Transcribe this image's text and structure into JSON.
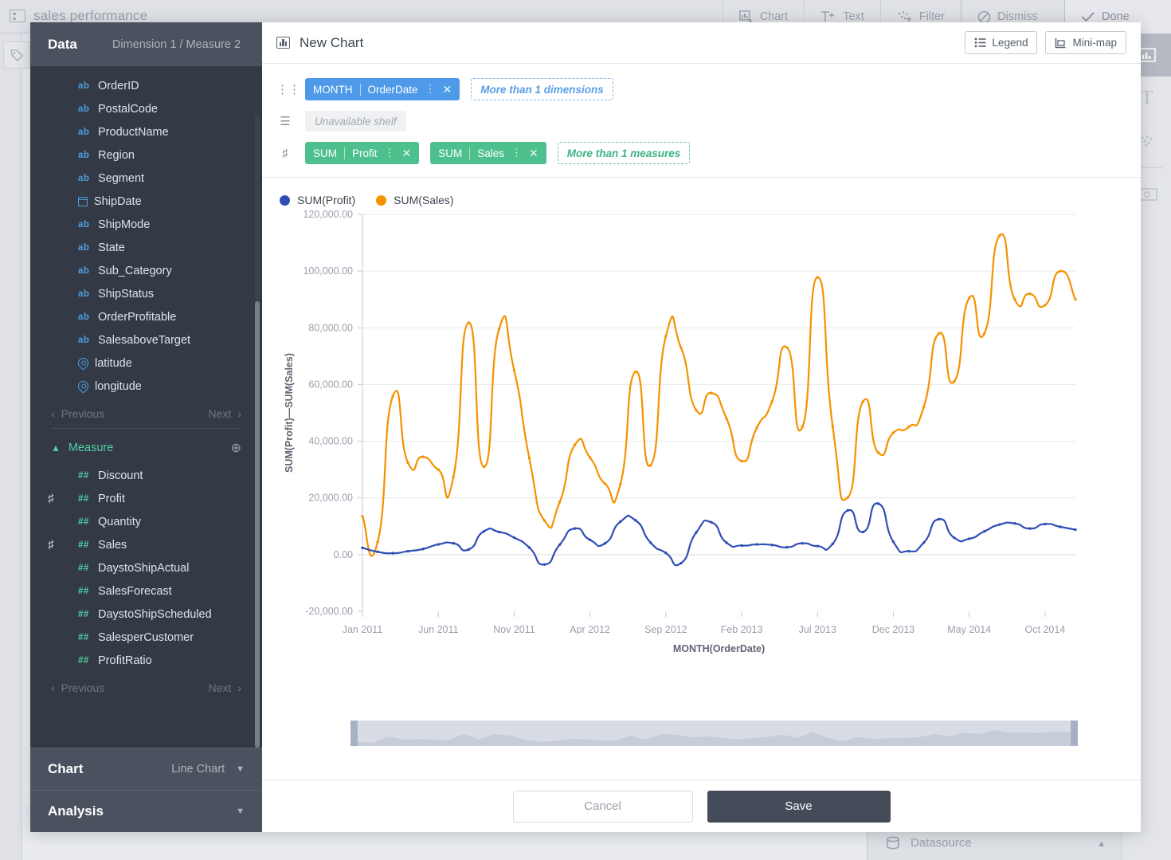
{
  "background": {
    "app_title": "sales performance",
    "toolbar": [
      {
        "label": "Chart",
        "icon": "chart-add-icon"
      },
      {
        "label": "Text",
        "icon": "text-add-icon"
      },
      {
        "label": "Filter",
        "icon": "filter-add-icon"
      },
      {
        "label": "Dismiss",
        "icon": "dismiss-icon"
      },
      {
        "label": "Done",
        "icon": "check-icon"
      }
    ],
    "datasource_label": "Datasource",
    "right_rail_icons": [
      "scatter-icon",
      "bar-chart-icon",
      "palette-icon",
      "number-123-icon",
      "y-axis-icon",
      "x-axis-icon",
      "text-box-icon",
      "comment-icon"
    ],
    "secondary_rail_icons": [
      "bar-chart-icon",
      "text-icon",
      "scatter-icon",
      "settings-icon"
    ]
  },
  "panel": {
    "title": "Data",
    "subtitle": "Dimension 1 / Measure 2",
    "dimension_fields": [
      {
        "name": "OrderID",
        "type": "ab",
        "icon": "abc-icon",
        "on_shelf": false
      },
      {
        "name": "PostalCode",
        "type": "ab",
        "icon": "abc-icon",
        "on_shelf": false
      },
      {
        "name": "ProductName",
        "type": "ab",
        "icon": "abc-icon",
        "on_shelf": false
      },
      {
        "name": "Region",
        "type": "ab",
        "icon": "abc-icon",
        "on_shelf": false
      },
      {
        "name": "Segment",
        "type": "ab",
        "icon": "abc-icon",
        "on_shelf": false
      },
      {
        "name": "ShipDate",
        "type": "date",
        "icon": "calendar-icon",
        "on_shelf": false
      },
      {
        "name": "ShipMode",
        "type": "ab",
        "icon": "abc-icon",
        "on_shelf": false
      },
      {
        "name": "State",
        "type": "ab",
        "icon": "abc-icon",
        "on_shelf": false
      },
      {
        "name": "Sub_Category",
        "type": "ab",
        "icon": "abc-icon",
        "on_shelf": false
      },
      {
        "name": "ShipStatus",
        "type": "ab",
        "icon": "abc-icon",
        "on_shelf": false
      },
      {
        "name": "OrderProfitable",
        "type": "ab",
        "icon": "abc-icon",
        "on_shelf": false
      },
      {
        "name": "SalesaboveTarget",
        "type": "ab",
        "icon": "abc-icon",
        "on_shelf": false
      },
      {
        "name": "latitude",
        "type": "geo",
        "icon": "location-icon",
        "on_shelf": false
      },
      {
        "name": "longitude",
        "type": "geo",
        "icon": "location-icon",
        "on_shelf": false
      }
    ],
    "dimension_pager": {
      "previous": "Previous",
      "next": "Next"
    },
    "measure_group": {
      "label": "Measure",
      "collapse_icon": "chevron-up-icon",
      "add_icon": "plus-circle-icon"
    },
    "measure_fields": [
      {
        "name": "Discount",
        "type": "##",
        "on_shelf": false
      },
      {
        "name": "Profit",
        "type": "##",
        "on_shelf": true
      },
      {
        "name": "Quantity",
        "type": "##",
        "on_shelf": false
      },
      {
        "name": "Sales",
        "type": "##",
        "on_shelf": true
      },
      {
        "name": "DaystoShipActual",
        "type": "##",
        "on_shelf": false
      },
      {
        "name": "SalesForecast",
        "type": "##",
        "on_shelf": false
      },
      {
        "name": "DaystoShipScheduled",
        "type": "##",
        "on_shelf": false
      },
      {
        "name": "SalesperCustomer",
        "type": "##",
        "on_shelf": false
      },
      {
        "name": "ProfitRatio",
        "type": "##",
        "on_shelf": false
      }
    ],
    "measure_pager": {
      "previous": "Previous",
      "next": "Next"
    },
    "chart_section": {
      "title": "Chart",
      "value": "Line Chart",
      "caret": "chevron-down-icon"
    },
    "analysis_section": {
      "title": "Analysis",
      "caret": "chevron-down-icon"
    }
  },
  "chart_header": {
    "icon": "bar-chart-icon",
    "name": "New Chart",
    "legend_button": "Legend",
    "minimap_button": "Mini-map"
  },
  "shelves": {
    "dimension_row": {
      "icon": "columns-icon",
      "pills": [
        {
          "agg": "MONTH",
          "field": "OrderDate"
        }
      ],
      "placeholder": "More than 1 dimensions"
    },
    "unavailable_row": {
      "icon": "rows-icon",
      "placeholder": "Unavailable  shelf"
    },
    "measure_row": {
      "icon": "hash-icon",
      "pills": [
        {
          "agg": "SUM",
          "field": "Profit"
        },
        {
          "agg": "SUM",
          "field": "Sales"
        }
      ],
      "placeholder": "More than 1 measures"
    }
  },
  "footer": {
    "cancel": "Cancel",
    "save": "Save"
  },
  "colors": {
    "profit": "#2f4eb5",
    "sales": "#f59200",
    "pill_blue": "#4e9ae8",
    "pill_green": "#4ec08e",
    "panel_dark": "#333a45",
    "panel_head": "#4a525f",
    "save_button": "#454c59"
  },
  "chart_data": {
    "type": "line",
    "title": "",
    "xlabel": "MONTH(OrderDate)",
    "ylabel": "SUM(Profit)—SUM(Sales)",
    "ylim": [
      -20000,
      120000
    ],
    "yticks": [
      -20000,
      0,
      20000,
      40000,
      60000,
      80000,
      100000,
      120000
    ],
    "ytick_labels": [
      "-20,000.00",
      "0.00",
      "20,000.00",
      "40,000.00",
      "60,000.00",
      "80,000.00",
      "100,000.00",
      "120,000.00"
    ],
    "xtick_labels": [
      "Jan 2011",
      "Jun 2011",
      "Nov 2011",
      "Apr 2012",
      "Sep 2012",
      "Feb 2013",
      "Jul 2013",
      "Dec 2013",
      "May 2014",
      "Oct 2014"
    ],
    "grid": true,
    "legend_position": "top-left",
    "x": [
      "Jan 2011",
      "Feb 2011",
      "Mar 2011",
      "Apr 2011",
      "May 2011",
      "Jun 2011",
      "Jul 2011",
      "Aug 2011",
      "Sep 2011",
      "Oct 2011",
      "Nov 2011",
      "Dec 2011",
      "Jan 2012",
      "Feb 2012",
      "Mar 2012",
      "Apr 2012",
      "May 2012",
      "Jun 2012",
      "Jul 2012",
      "Aug 2012",
      "Sep 2012",
      "Oct 2012",
      "Nov 2012",
      "Dec 2012",
      "Jan 2013",
      "Feb 2013",
      "Mar 2013",
      "Apr 2013",
      "May 2013",
      "Jun 2013",
      "Jul 2013",
      "Aug 2013",
      "Sep 2013",
      "Oct 2013",
      "Nov 2013",
      "Dec 2013",
      "Jan 2014",
      "Feb 2014",
      "Mar 2014",
      "Apr 2014",
      "May 2014",
      "Jun 2014",
      "Jul 2014",
      "Aug 2014",
      "Sep 2014",
      "Oct 2014",
      "Nov 2014",
      "Dec 2014"
    ],
    "series": [
      {
        "name": "SUM(Profit)",
        "color": "#2f4eb5",
        "values": [
          2400,
          1000,
          500,
          1200,
          2000,
          3600,
          4000,
          1800,
          8200,
          8000,
          6000,
          2500,
          -3500,
          3500,
          9200,
          5200,
          4000,
          11600,
          12100,
          4200,
          600,
          -3000,
          7800,
          11400,
          4200,
          3200,
          3600,
          3400,
          2600,
          4000,
          3000,
          3800,
          15600,
          8000,
          18000,
          4500,
          1200,
          4200,
          12500,
          6000,
          5600,
          8200,
          10600,
          11000,
          9200,
          10800,
          9800,
          8800
        ]
      },
      {
        "name": "SUM(Sales)",
        "color": "#f59200",
        "values": [
          13500,
          4400,
          55800,
          32400,
          34500,
          30000,
          27500,
          81800,
          31000,
          79500,
          65000,
          34000,
          12000,
          18500,
          38700,
          34200,
          25000,
          24800,
          64500,
          31500,
          77000,
          73000,
          51000,
          57000,
          48000,
          33000,
          44800,
          54000,
          73000,
          45000,
          97800,
          45200,
          20200,
          54000,
          36000,
          43000,
          45000,
          52000,
          78000,
          61000,
          90500,
          78000,
          112500,
          90000,
          92000,
          88000,
          100000,
          90000
        ]
      }
    ]
  }
}
